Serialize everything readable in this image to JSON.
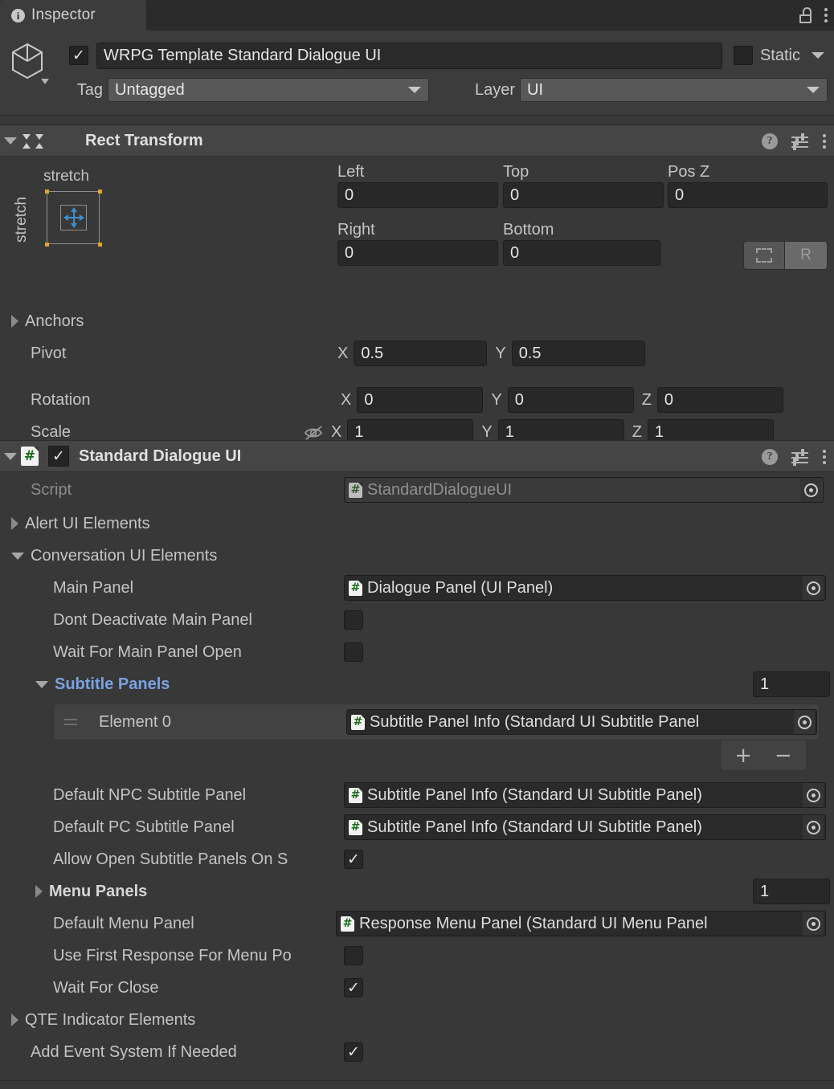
{
  "window": {
    "tab_label": "Inspector",
    "info_icon": "info-icon",
    "lock_icon": "lock-icon",
    "menu_icon": "kebab-menu-icon"
  },
  "colors": {
    "background": "#383838",
    "header": "#3c3c3c",
    "component_header": "#454545",
    "field": "#282828",
    "accent_blue": "#7aa2e3",
    "anchor_handle": "#e0a52a",
    "script_green": "#186a18"
  },
  "game_object": {
    "enabled": true,
    "name": "WRPG Template Standard Dialogue UI",
    "static_label": "Static",
    "static_checked": false,
    "tag_label": "Tag",
    "tag_value": "Untagged",
    "layer_label": "Layer",
    "layer_value": "UI"
  },
  "rect_transform": {
    "title": "Rect Transform",
    "expanded": true,
    "anchor_preset": {
      "top_label": "stretch",
      "left_label": "stretch"
    },
    "fields": {
      "left_label": "Left",
      "left_value": "0",
      "top_label": "Top",
      "top_value": "0",
      "posz_label": "Pos Z",
      "posz_value": "0",
      "right_label": "Right",
      "right_value": "0",
      "bottom_label": "Bottom",
      "bottom_value": "0"
    },
    "blueprint_button": "blueprint-mode-icon",
    "raw_button": "R",
    "anchors_label": "Anchors",
    "pivot_label": "Pivot",
    "pivot_x": "0.5",
    "pivot_y": "0.5",
    "rotation_label": "Rotation",
    "rotation_x": "0",
    "rotation_y": "0",
    "rotation_z": "0",
    "scale_label": "Scale",
    "scale_x": "1",
    "scale_y": "1",
    "scale_z": "1",
    "axis_x": "X",
    "axis_y": "Y",
    "axis_z": "Z"
  },
  "component": {
    "title": "Standard Dialogue UI",
    "enabled": true,
    "expanded": true,
    "script_label": "Script",
    "script_value": "StandardDialogueUI",
    "alert_ui_elements": "Alert UI Elements",
    "conversation_ui_elements": "Conversation UI Elements",
    "main_panel_label": "Main Panel",
    "main_panel_value": "Dialogue Panel (UI Panel)",
    "dont_deactivate_label": "Dont Deactivate Main Panel",
    "dont_deactivate_checked": false,
    "wait_for_main_panel_label": "Wait For Main Panel Open",
    "wait_for_main_panel_checked": false,
    "subtitle_panels_label": "Subtitle Panels",
    "subtitle_panels_count": "1",
    "element0_label": "Element 0",
    "element0_value": "Subtitle Panel Info (Standard UI Subtitle Panel",
    "add_button": "+",
    "remove_button": "−",
    "default_npc_label": "Default NPC Subtitle Panel",
    "default_npc_value": "Subtitle Panel Info (Standard UI Subtitle Panel)",
    "default_pc_label": "Default PC Subtitle Panel",
    "default_pc_value": "Subtitle Panel Info (Standard UI Subtitle Panel)",
    "allow_open_label": "Allow Open Subtitle Panels On S",
    "allow_open_checked": true,
    "menu_panels_label": "Menu Panels",
    "menu_panels_count": "1",
    "default_menu_label": "Default Menu Panel",
    "default_menu_value": "Response Menu Panel (Standard UI Menu Panel",
    "use_first_response_label": "Use First Response For Menu Po",
    "use_first_response_checked": false,
    "wait_for_close_label": "Wait For Close",
    "wait_for_close_checked": true,
    "qte_label": "QTE Indicator Elements",
    "add_event_system_label": "Add Event System If Needed",
    "add_event_system_checked": true
  }
}
